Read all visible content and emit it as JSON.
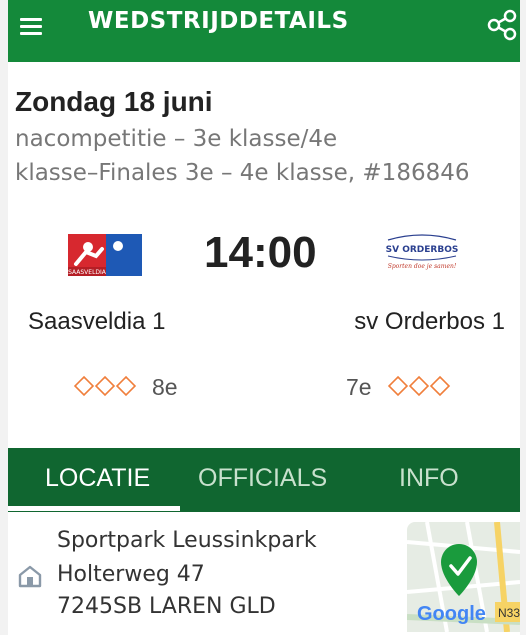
{
  "appbar": {
    "title": "WEDSTRIJDDETAILS",
    "menu_icon": "hamburger-menu-icon",
    "share_icon": "share-icon"
  },
  "match": {
    "date": "Zondag 18 juni",
    "competition_line1": "nacompetitie – 3e klasse/4e",
    "competition_line2": "klasse–Finales 3e – 4e klasse, #186846",
    "kickoff": "14:00",
    "home": {
      "name": "Saasveldia 1",
      "rank": "8e",
      "logo_text": "SAASVELDIA",
      "rating_icon": "diamond-rating-icon"
    },
    "away": {
      "name": "sv Orderbos 1",
      "rank": "7e",
      "logo_text": "SV ORDERBOS",
      "logo_slogan": "Sporten doe je samen!",
      "rating_icon": "diamond-rating-icon"
    }
  },
  "tabs": [
    {
      "label": "LOCATIE",
      "active": true
    },
    {
      "label": "OFFICIALS",
      "active": false
    },
    {
      "label": "INFO",
      "active": false
    }
  ],
  "location": {
    "name": "Sportpark Leussinkpark",
    "street": "Holterweg 47",
    "city": "7245SB LAREN GLD",
    "icon": "home-icon",
    "map_label": "Google",
    "map_road": "N33"
  },
  "colors": {
    "primary": "#14893a",
    "tabs_bg": "#106630",
    "accent": "#f07f3c"
  }
}
